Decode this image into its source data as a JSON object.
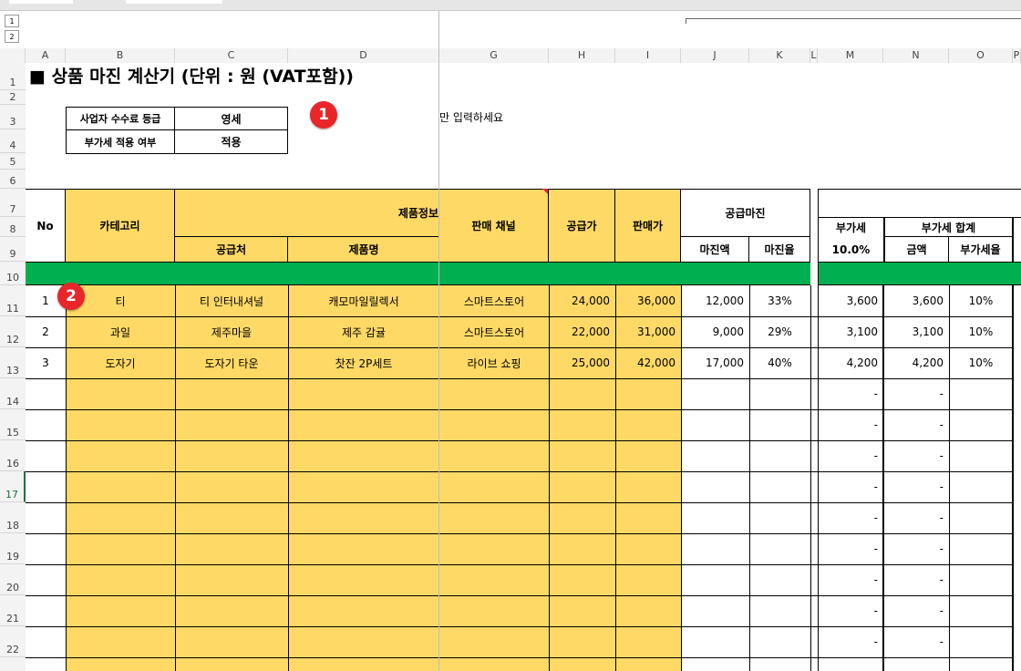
{
  "outline_levels": [
    "1",
    "2"
  ],
  "columns": [
    "A",
    "B",
    "C",
    "D",
    "G",
    "H",
    "I",
    "J",
    "K",
    "L",
    "M",
    "N",
    "O",
    "P"
  ],
  "rows": [
    "1",
    "2",
    "3",
    "4",
    "5",
    "6",
    "7",
    "8",
    "9",
    "10",
    "11",
    "12",
    "13",
    "14",
    "15",
    "16",
    "17",
    "18",
    "19",
    "20",
    "21",
    "22"
  ],
  "title": "■ 상품 마진 계산기 (단위 : 원 (VAT포함))",
  "settings": {
    "grade_label": "사업자 수수료 등급",
    "grade_value": "영세",
    "vat_label": "부가세 적용 여부",
    "vat_value": "적용"
  },
  "hint_text": "만 입력하세요",
  "badges": [
    "1",
    "2"
  ],
  "headers": {
    "no": "No",
    "category": "카테고리",
    "product_info": "제품정보",
    "supplier": "공급처",
    "product_name": "제품명",
    "channel": "판매 채널",
    "supply_price": "공급가",
    "sale_price": "판매가",
    "supply_margin": "공급마진",
    "margin_amount": "마진액",
    "margin_rate": "마진율",
    "vat": "부가세",
    "vat_rate": "10.0%",
    "vat_total": "부가세 합계",
    "amount": "금액",
    "vat_ratio": "부가세율"
  },
  "table_rows": [
    {
      "no": "1",
      "category": "티",
      "supplier": "티 인터내셔널",
      "product": "캐모마일릴렉서",
      "channel": "스마트스토어",
      "supply": "24,000",
      "sale": "36,000",
      "margin_amt": "12,000",
      "margin_rate": "33%",
      "vat": "3,600",
      "vat_amt": "3,600",
      "vat_ratio": "10%"
    },
    {
      "no": "2",
      "category": "과일",
      "supplier": "제주마을",
      "product": "제주 감귤",
      "channel": "스마트스토어",
      "supply": "22,000",
      "sale": "31,000",
      "margin_amt": "9,000",
      "margin_rate": "29%",
      "vat": "3,100",
      "vat_amt": "3,100",
      "vat_ratio": "10%"
    },
    {
      "no": "3",
      "category": "도자기",
      "supplier": "도자기 타운",
      "product": "찻잔 2P세트",
      "channel": "라이브 쇼핑",
      "supply": "25,000",
      "sale": "42,000",
      "margin_amt": "17,000",
      "margin_rate": "40%",
      "vat": "4,200",
      "vat_amt": "4,200",
      "vat_ratio": "10%"
    }
  ],
  "empty_dash": "-",
  "colors": {
    "yellow": "#ffd966",
    "green": "#00b050",
    "badge_red": "#e8262a"
  }
}
